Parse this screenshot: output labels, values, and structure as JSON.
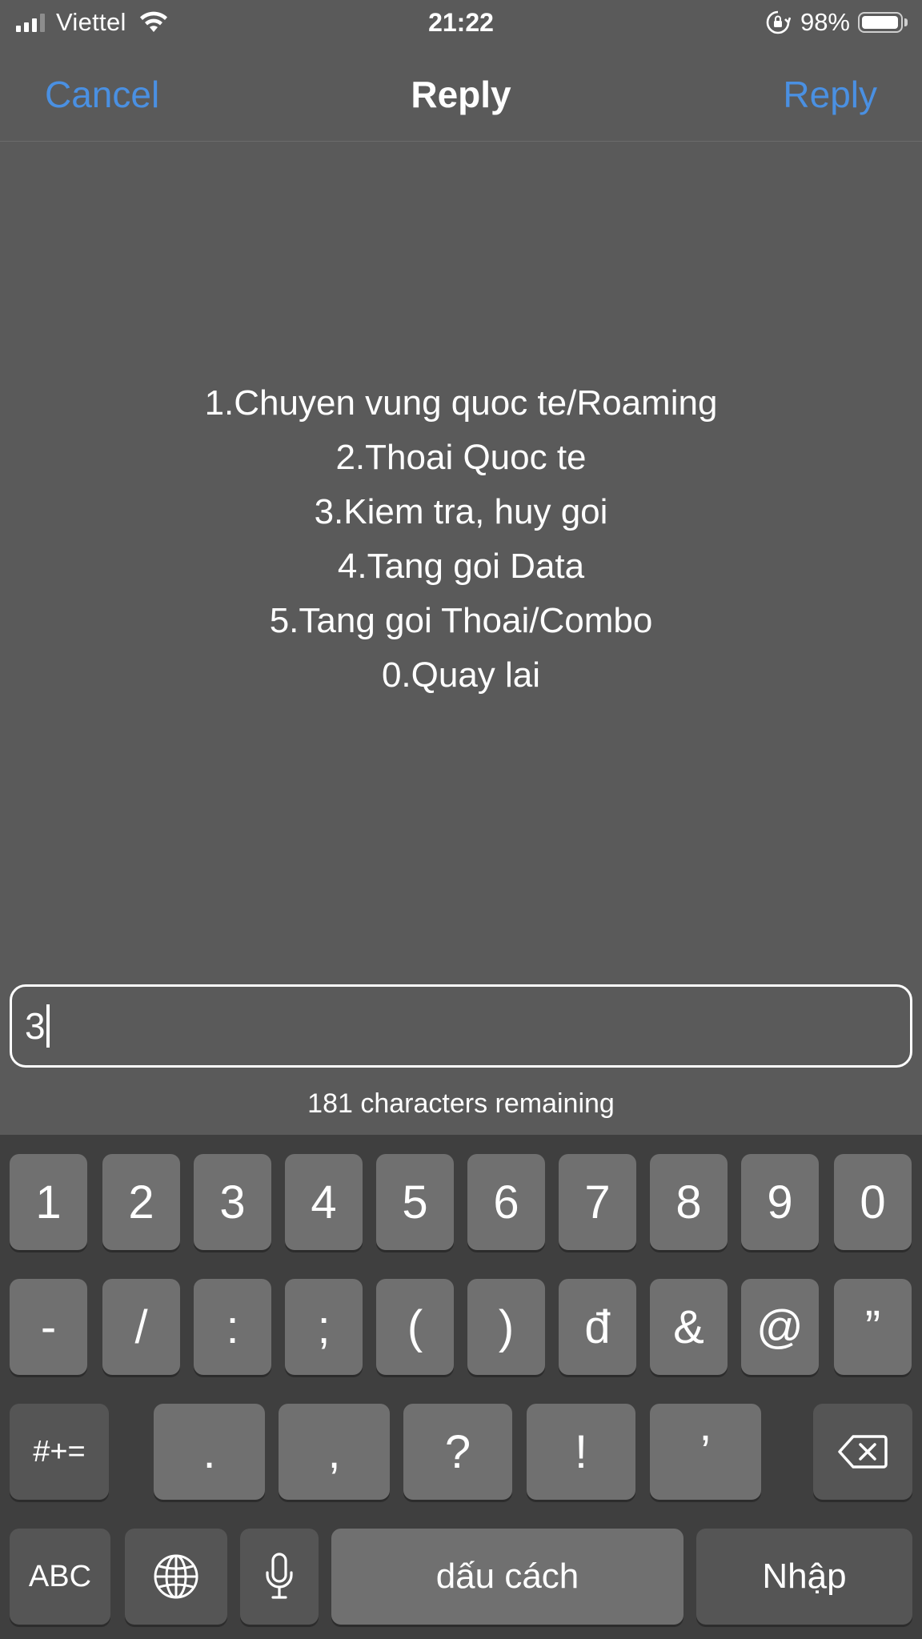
{
  "status_bar": {
    "carrier": "Viettel",
    "time": "21:22",
    "battery_percent": "98%",
    "battery_level": 0.98,
    "signal_bars_active": 3,
    "signal_bars_total": 4
  },
  "nav": {
    "cancel_label": "Cancel",
    "title": "Reply",
    "reply_label": "Reply",
    "accent_color": "#4a90e2"
  },
  "message": {
    "lines": [
      "1.Chuyen vung quoc te/Roaming",
      "2.Thoai Quoc te",
      "3.Kiem tra, huy goi",
      "4.Tang goi Data",
      "5.Tang goi Thoai/Combo",
      "0.Quay lai"
    ]
  },
  "reply": {
    "value": "3",
    "remaining_text": "181 characters remaining"
  },
  "keyboard": {
    "row1": [
      "1",
      "2",
      "3",
      "4",
      "5",
      "6",
      "7",
      "8",
      "9",
      "0"
    ],
    "row2": [
      "-",
      "/",
      ":",
      ";",
      "(",
      ")",
      "đ",
      "&",
      "@",
      "”"
    ],
    "row3": {
      "toggle": "#+=",
      "keys": [
        ".",
        ",",
        "?",
        "!",
        "’"
      ],
      "backspace_icon": "backspace-icon"
    },
    "row4": {
      "abc": "ABC",
      "globe_icon": "globe-icon",
      "mic_icon": "microphone-icon",
      "space": "dấu cách",
      "return": "Nhập"
    }
  }
}
